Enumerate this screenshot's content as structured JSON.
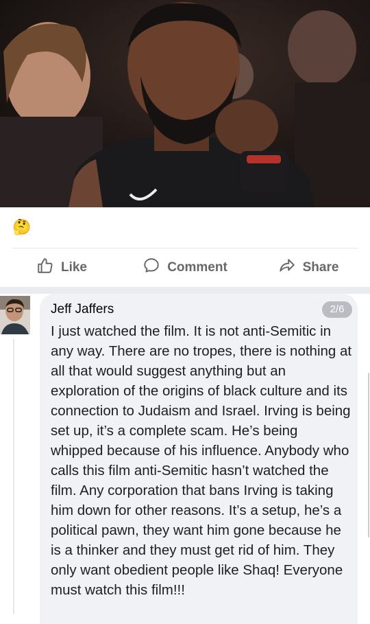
{
  "post": {
    "photo_alt": "Basketball player in black jersey, hand on beard",
    "reaction_emoji": "🤔",
    "reaction_icon": "thinking-face-icon"
  },
  "actions": {
    "like_label": "Like",
    "comment_label": "Comment",
    "share_label": "Share"
  },
  "comment": {
    "author": "Jeff Jaffers",
    "page_badge": "2/6",
    "text": "I just watched the film. It is not anti-Semitic in any way. There are no tropes, there is nothing at all that would suggest anything but an exploration of the origins of black culture and its connection to Judaism and Israel. Irving is being set up, it’s a complete scam. He’s being whipped because of his influence. Anybody who calls this film anti-Semitic hasn’t watched the film. Any corporation that bans Irving is taking him down for other reasons. It’s a setup, he’s a political pawn, they want him gone because he is a thinker and they must get rid of him. They only want obedient people like Shaq! Everyone must watch this film!!!"
  },
  "colors": {
    "action_text": "#65676b",
    "bubble_bg": "#f0f2f5",
    "badge_bg": "#b9bcc2"
  }
}
